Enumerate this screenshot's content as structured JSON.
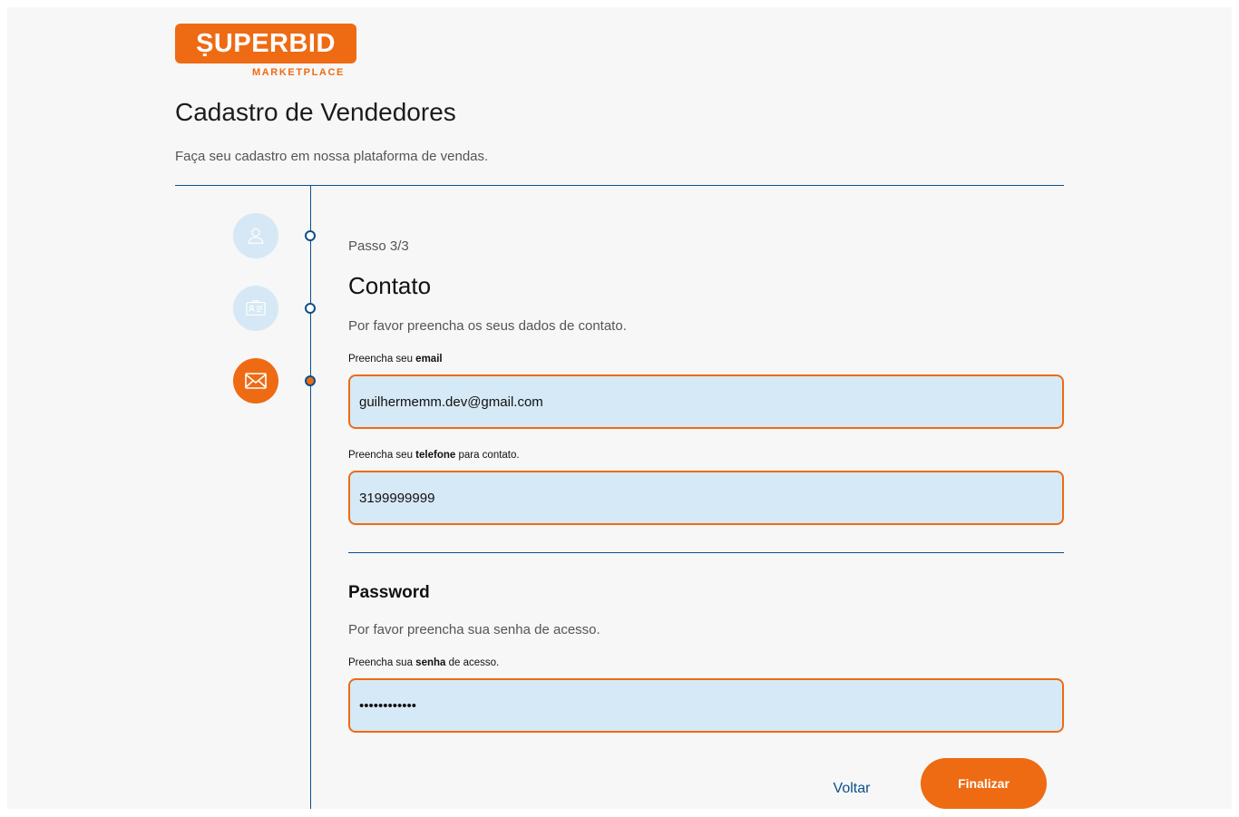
{
  "logo": {
    "brand": "ṢUPERBID",
    "sub": "MARKETPLACE",
    "color": "#ee6b13"
  },
  "header": {
    "title": "Cadastro de Vendedores",
    "subtitle": "Faça seu cadastro em nossa plataforma de vendas."
  },
  "steps": [
    {
      "icon": "user-icon",
      "state": "completed"
    },
    {
      "icon": "id-card-icon",
      "state": "completed"
    },
    {
      "icon": "envelope-icon",
      "state": "active"
    }
  ],
  "contact": {
    "step_label": "Passo 3/3",
    "title": "Contato",
    "description": "Por favor preencha os seus dados de contato.",
    "email": {
      "label_pre": "Preencha seu ",
      "label_bold": "email",
      "label_post": "",
      "value": "guilhermemm.dev@gmail.com"
    },
    "phone": {
      "label_pre": "Preencha seu ",
      "label_bold": "telefone",
      "label_post": " para contato.",
      "value": "3199999999"
    }
  },
  "password": {
    "title": "Password",
    "description": "Por favor preencha sua senha de acesso.",
    "label_pre": "Preencha sua ",
    "label_bold": "senha",
    "label_post": " de acesso.",
    "value": "••••••••••••"
  },
  "actions": {
    "back_label": "Voltar",
    "submit_label": "Finalizar"
  },
  "colors": {
    "accent": "#ee6b13",
    "primary": "#0b4f8a",
    "input_bg": "#d6e9f6",
    "step_inactive_bg": "#d6e8f5"
  }
}
